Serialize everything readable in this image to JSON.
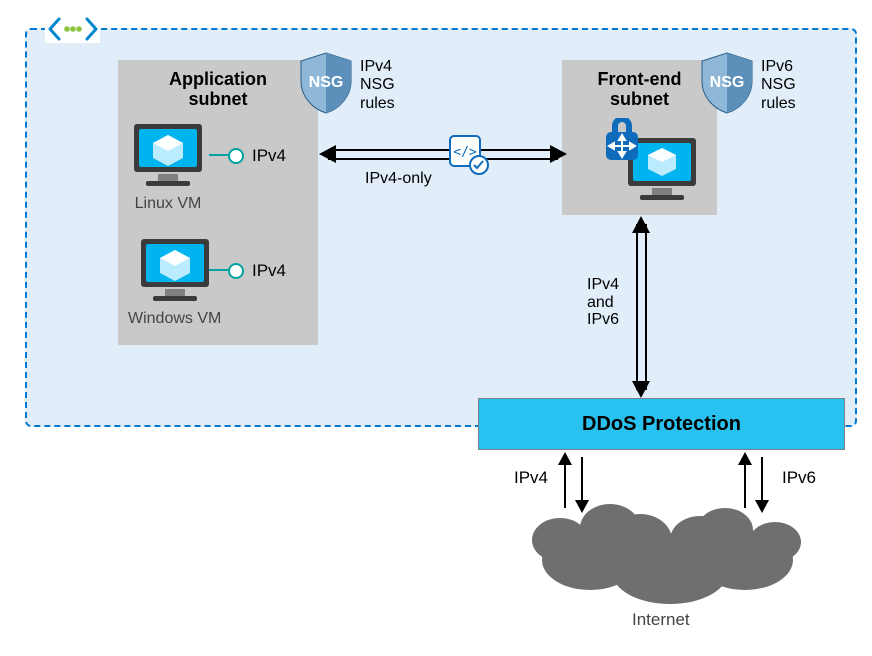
{
  "vnet": {
    "icon_name": "virtual-network"
  },
  "subnets": {
    "app": {
      "title_l1": "Application",
      "title_l2": "subnet"
    },
    "fe": {
      "title_l1": "Front-end",
      "title_l2": "subnet"
    }
  },
  "vms": {
    "linux": {
      "label": "Linux VM",
      "nic_proto": "IPv4"
    },
    "windows": {
      "label": "Windows VM",
      "nic_proto": "IPv4"
    }
  },
  "nsg": {
    "app": {
      "badge": "NSG",
      "rules_l1": "IPv4",
      "rules_l2": "NSG",
      "rules_l3": "rules"
    },
    "fe": {
      "badge": "NSG",
      "rules_l1": "IPv6",
      "rules_l2": "NSG",
      "rules_l3": "rules"
    }
  },
  "links": {
    "app_to_fe": {
      "label": "IPv4-only"
    },
    "fe_to_ddos": {
      "l1": "IPv4",
      "l2": "and",
      "l3": "IPv6"
    }
  },
  "ddos": {
    "label": "DDoS Protection"
  },
  "internet": {
    "label": "Internet",
    "left_proto": "IPv4",
    "right_proto": "IPv6"
  }
}
